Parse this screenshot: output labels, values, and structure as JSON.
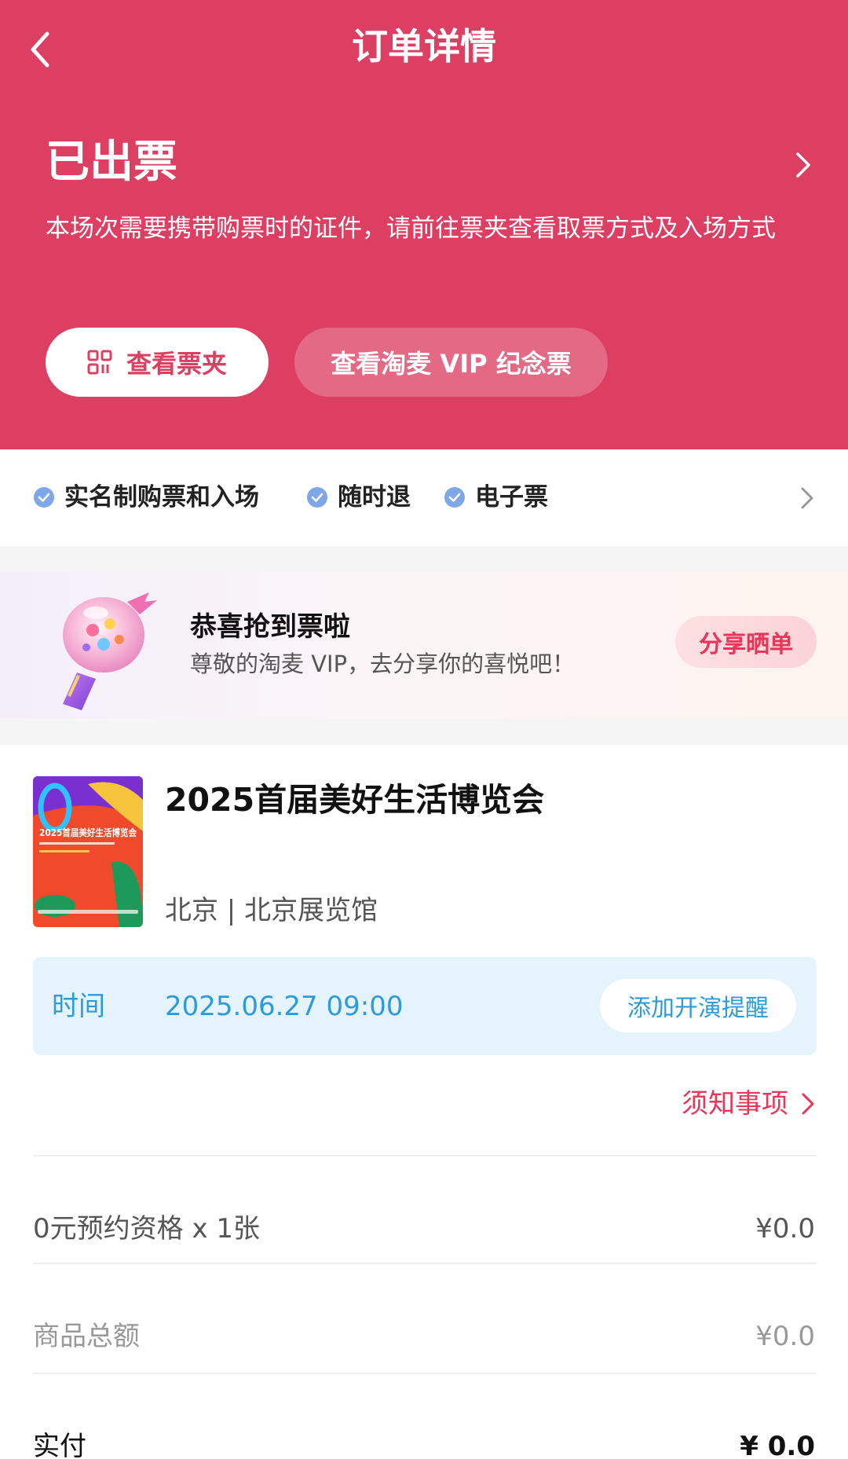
{
  "nav": {
    "title": "订单详情"
  },
  "status": {
    "title": "已出票",
    "description": "本场次需要携带购票时的证件，请前往票夹查看取票方式及入场方式"
  },
  "actions": {
    "wallet_label": "查看票夹",
    "vip_label": "查看淘麦 VIP 纪念票"
  },
  "features": [
    {
      "label": "实名制购票和入场"
    },
    {
      "label": "随时退"
    },
    {
      "label": "电子票"
    }
  ],
  "promo": {
    "title": "恭喜抢到票啦",
    "subtitle": "尊敬的淘麦 VIP，去分享你的喜悦吧！",
    "button": "分享晒单"
  },
  "event": {
    "title": "2025首届美好生活博览会",
    "venue": "北京 | 北京展览馆",
    "poster_text": "2025首届美好生活博览会",
    "time_label": "时间",
    "time_value": "2025.06.27 09:00",
    "remind_button": "添加开演提醒",
    "notice_link": "须知事项"
  },
  "order": {
    "item_label": "0元预约资格 x 1张",
    "item_price": "¥0.0",
    "subtotal_label": "商品总额",
    "subtotal_value": "¥0.0",
    "paid_label": "实付",
    "paid_value": "¥ 0.0"
  },
  "colors": {
    "brand": "#dc3f62",
    "accent_pink": "#e8365a",
    "info_blue": "#2d9bd9",
    "check_blue": "#7fa6e6"
  },
  "icons": {
    "back": "chevron-left-icon",
    "status": "chevron-right-icon",
    "wallet": "qr-code-icon",
    "feature_check": "check-circle-icon",
    "notice": "chevron-right-icon"
  }
}
